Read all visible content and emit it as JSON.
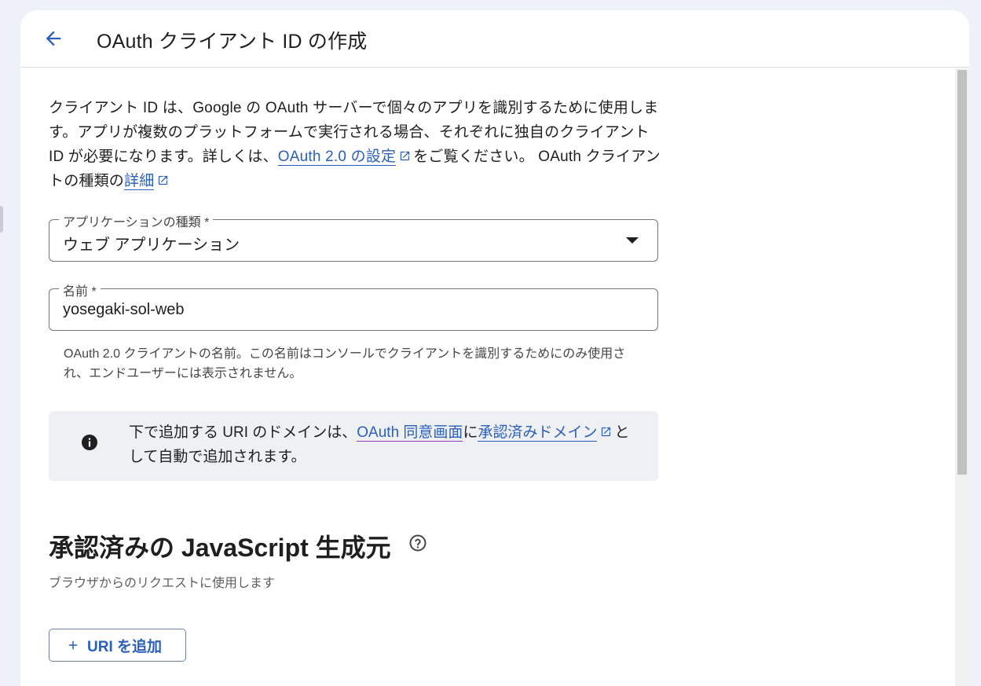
{
  "header": {
    "title": "OAuth クライアント ID の作成"
  },
  "intro": {
    "text_1": "クライアント ID は、Google の OAuth サーバーで個々のアプリを識別するために使用します。アプリが複数のプラットフォームで実行される場合、それぞれに独自のクライアント ID が必要になります。詳しくは、",
    "link_1": "OAuth 2.0 の設定",
    "text_2": "をご覧ください。 OAuth クライアントの種類の",
    "link_2": "詳細"
  },
  "app_type": {
    "label": "アプリケーションの種類 *",
    "value": "ウェブ アプリケーション"
  },
  "name_field": {
    "label": "名前 *",
    "value": "yosegaki-sol-web",
    "helper": "OAuth 2.0 クライアントの名前。この名前はコンソールでクライアントを識別するためにのみ使用され、エンドユーザーには表示されません。"
  },
  "info": {
    "text_1": "下で追加する URI のドメインは、",
    "link_1": "OAuth 同意画面",
    "text_2": "に",
    "link_2": "承認済みドメイン",
    "text_3": "として自動で追加されます。"
  },
  "js_origins": {
    "title": "承認済みの JavaScript 生成元",
    "subtitle": "ブラウザからのリクエストに使用します",
    "add_button": "URI を追加"
  },
  "colors": {
    "accent": "#2b5fb9",
    "background": "#eef0fa",
    "info_bg": "#eef0f4"
  },
  "icons": [
    "arrow-back-icon",
    "external-link-icon",
    "dropdown-caret-icon",
    "info-icon",
    "help-icon",
    "plus-icon"
  ]
}
